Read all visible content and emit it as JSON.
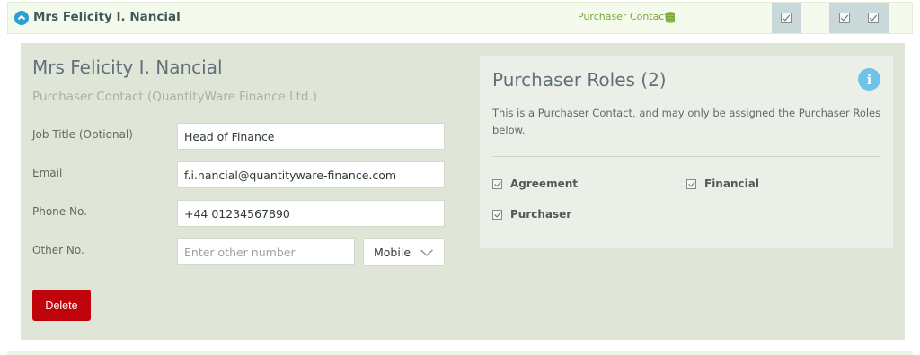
{
  "row": {
    "name": "Mrs Felicity I. Nancial",
    "type_label": "Purchaser Contact",
    "type_icon": "money-icon"
  },
  "detail": {
    "title": "Mrs Felicity I. Nancial",
    "subtitle": "Purchaser Contact (QuantityWare Finance Ltd.)",
    "fields": {
      "job_title_label": "Job Title (Optional)",
      "job_title_value": "Head of Finance",
      "email_label": "Email",
      "email_value": "f.i.nancial@quantityware-finance.com",
      "phone_label": "Phone No.",
      "phone_value": "+44 01234567890",
      "other_label": "Other No.",
      "other_placeholder": "Enter other number",
      "other_type": "Mobile"
    },
    "delete_label": "Delete"
  },
  "roles": {
    "title": "Purchaser Roles (2)",
    "description": "This is a Purchaser Contact, and may only be assigned the Purchaser Roles below.",
    "items": [
      {
        "label": "Agreement"
      },
      {
        "label": "Financial"
      },
      {
        "label": "Purchaser"
      }
    ]
  },
  "colors": {
    "accent": "#2a9fd6",
    "delete": "#c0040c",
    "contact_type": "#7aa83a",
    "info": "#6fc3ea",
    "panel": "#dfe6d7"
  }
}
